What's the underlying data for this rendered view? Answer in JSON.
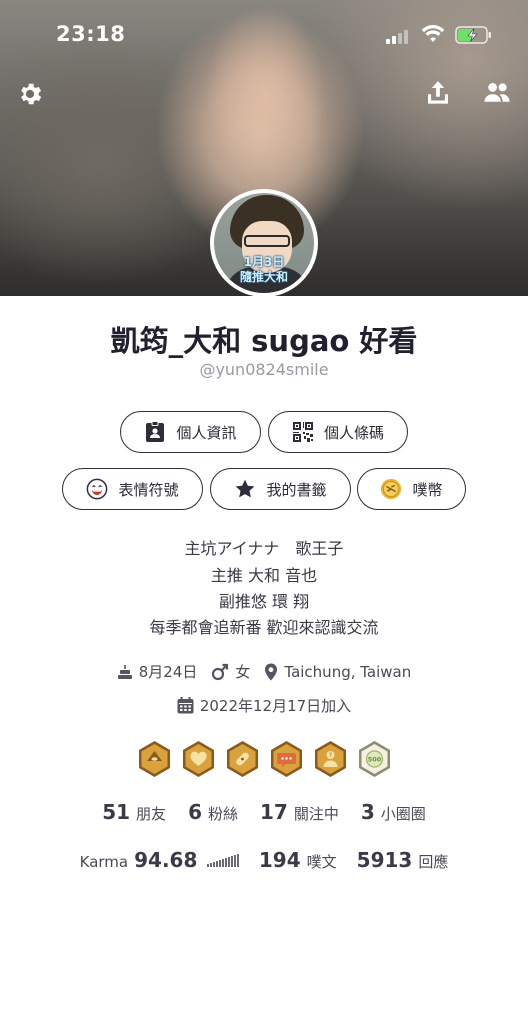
{
  "status_bar": {
    "time": "23:18"
  },
  "profile": {
    "display_name": "凱筠_大和 sugao 好看",
    "handle": "@yun0824smile",
    "avatar_caption_1": "1月3日",
    "avatar_caption_2": "隨推大和"
  },
  "buttons_row1": [
    {
      "label": "個人資訊",
      "icon": "id-card-icon"
    },
    {
      "label": "個人條碼",
      "icon": "qr-code-icon"
    }
  ],
  "buttons_row2": [
    {
      "label": "表情符號",
      "icon": "emoji-icon"
    },
    {
      "label": "我的書籤",
      "icon": "star-icon"
    },
    {
      "label": "噗幣",
      "icon": "coin-icon"
    }
  ],
  "bio": [
    "主坑アイナナ　歌王子",
    "主推 大和 音也",
    "副推悠 環 翔",
    "每季都會追新番 歡迎來認識交流"
  ],
  "meta": {
    "birthday": "8月24日",
    "gender": "女",
    "location": "Taichung, Taiwan",
    "joined": "2022年12月17日加入"
  },
  "badges": [
    "eye-badge-icon",
    "heart-badge-icon",
    "bandage-badge-icon",
    "chat-badge-icon",
    "person-badge-icon",
    "500-badge-icon"
  ],
  "stats": [
    {
      "value": "51",
      "label": "朋友"
    },
    {
      "value": "6",
      "label": "粉絲"
    },
    {
      "value": "17",
      "label": "關注中"
    },
    {
      "value": "3",
      "label": "小圈圈"
    }
  ],
  "stats2": {
    "karma_label": "Karma",
    "karma_value": "94.68",
    "plurks_value": "194",
    "plurks_label": "噗文",
    "responses_value": "5913",
    "responses_label": "回應"
  },
  "colors": {
    "accent_dark": "#2e2e3a",
    "badge_brown": "#8a5a1c",
    "badge_gold": "#d9a23c"
  }
}
